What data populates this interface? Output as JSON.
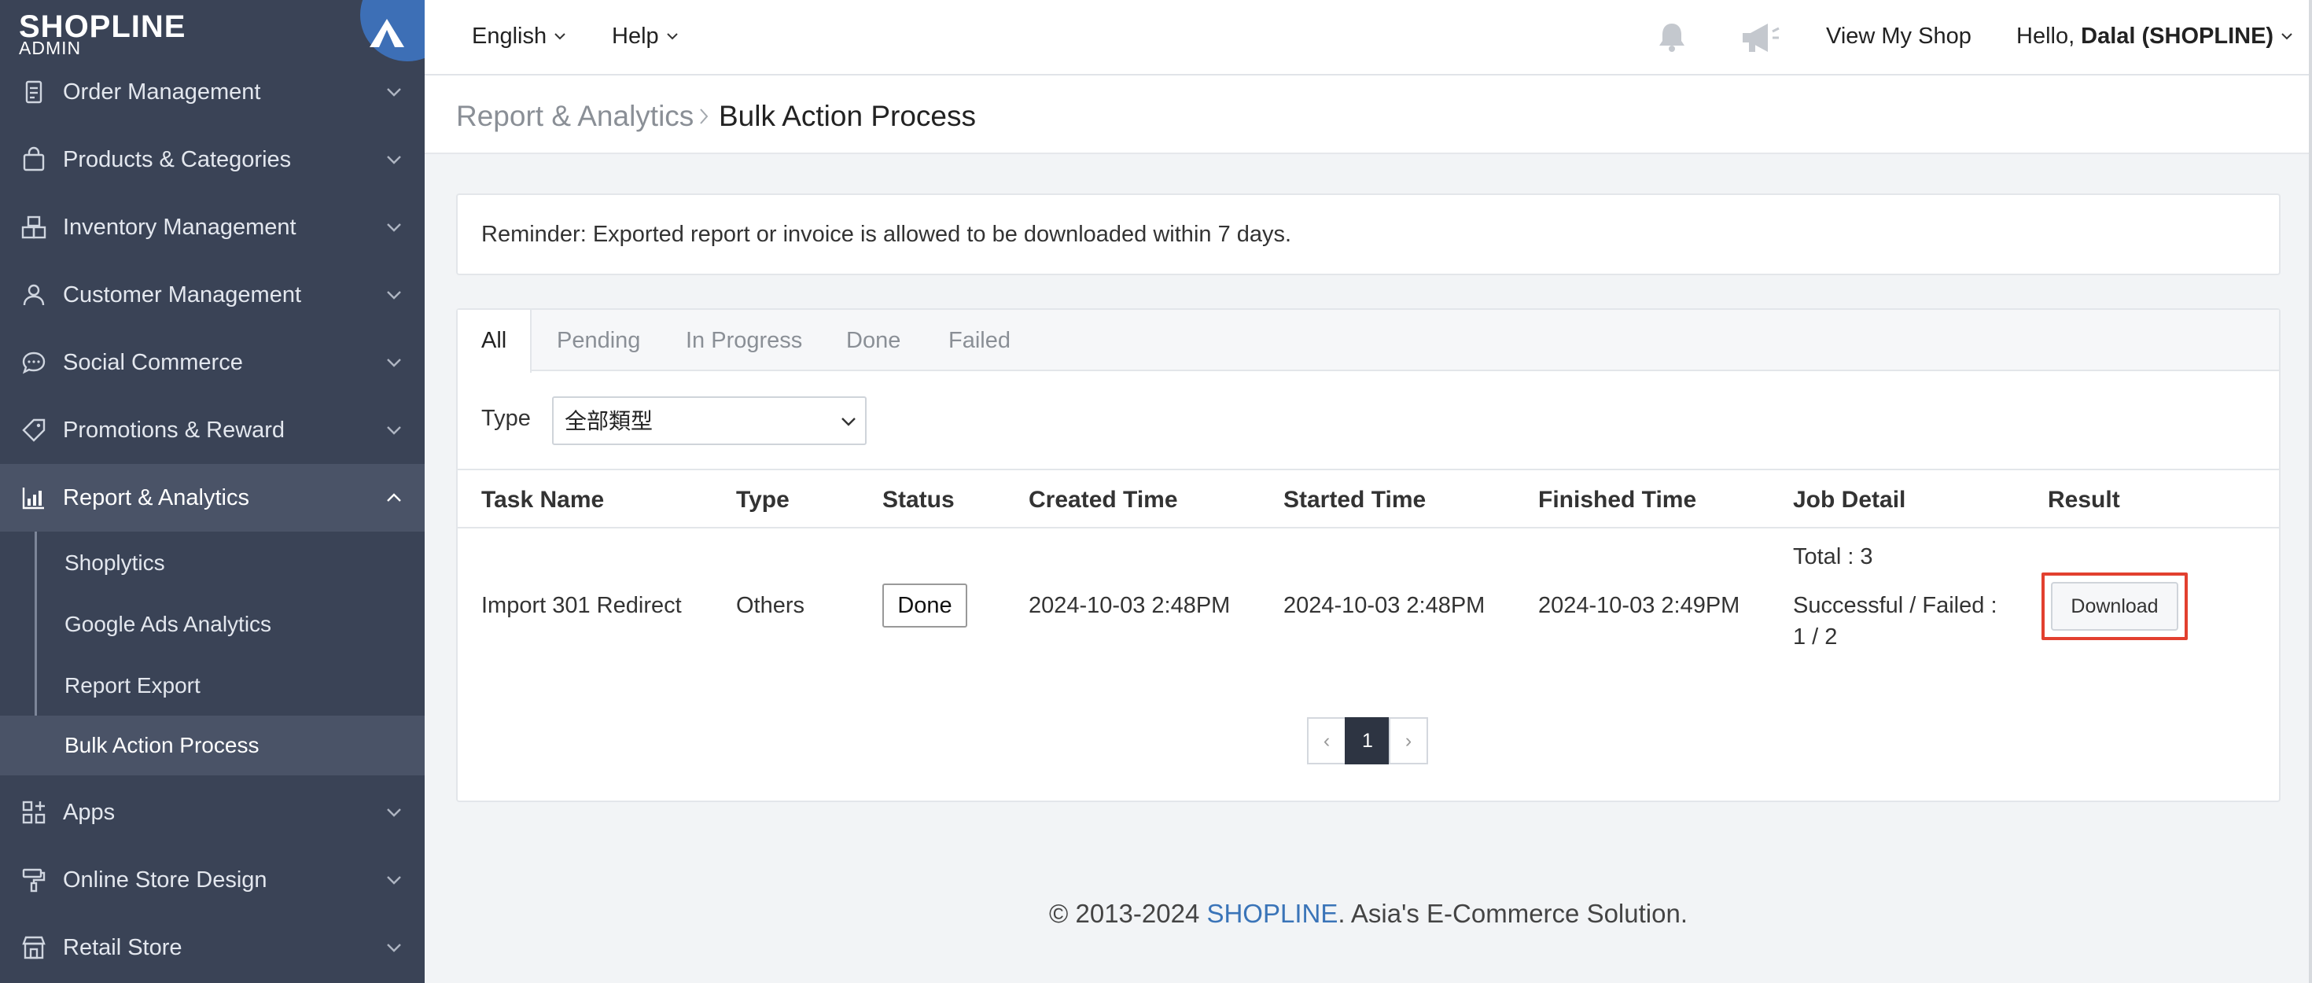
{
  "brand": {
    "name": "SHOPLINE",
    "sub": "ADMIN"
  },
  "sidebar": {
    "items": [
      {
        "label": "Order Management",
        "icon": "clipboard-icon"
      },
      {
        "label": "Products & Categories",
        "icon": "bag-icon"
      },
      {
        "label": "Inventory Management",
        "icon": "boxes-icon"
      },
      {
        "label": "Customer Management",
        "icon": "user-icon"
      },
      {
        "label": "Social Commerce",
        "icon": "chat-icon"
      },
      {
        "label": "Promotions & Reward",
        "icon": "tag-icon"
      },
      {
        "label": "Report & Analytics",
        "icon": "chart-icon",
        "expanded": true
      },
      {
        "label": "Apps",
        "icon": "apps-icon"
      },
      {
        "label": "Online Store Design",
        "icon": "paint-roller-icon"
      },
      {
        "label": "Retail Store",
        "icon": "store-icon"
      }
    ],
    "sub_items": [
      {
        "label": "Shoplytics"
      },
      {
        "label": "Google Ads Analytics"
      },
      {
        "label": "Report Export"
      },
      {
        "label": "Bulk Action Process",
        "active": true
      }
    ]
  },
  "topbar": {
    "language": "English",
    "help": "Help",
    "view_shop": "View My Shop",
    "greeting": "Hello,",
    "user": "Dalal (SHOPLINE)"
  },
  "breadcrumb": {
    "parent": "Report & Analytics",
    "current": "Bulk Action Process"
  },
  "reminder": "Reminder: Exported report or invoice is allowed to be downloaded within 7 days.",
  "tabs": [
    {
      "label": "All",
      "active": true
    },
    {
      "label": "Pending"
    },
    {
      "label": "In Progress"
    },
    {
      "label": "Done"
    },
    {
      "label": "Failed"
    }
  ],
  "filter": {
    "type_label": "Type",
    "type_value": "全部類型"
  },
  "table": {
    "columns": [
      "Task Name",
      "Type",
      "Status",
      "Created Time",
      "Started Time",
      "Finished Time",
      "Job Detail",
      "Result"
    ],
    "rows": [
      {
        "task_name": "Import 301 Redirect",
        "type": "Others",
        "status": "Done",
        "created": "2024-10-03 2:48PM",
        "started": "2024-10-03 2:48PM",
        "finished": "2024-10-03 2:49PM",
        "detail_total": "Total : 3",
        "detail_result_line1": "Successful / Failed :",
        "detail_result_line2": "1 / 2",
        "result_button": "Download"
      }
    ]
  },
  "pagination": {
    "prev": "‹",
    "current": "1",
    "next": "›"
  },
  "footer": {
    "prefix": "© 2013-2024 ",
    "brand": "SHOPLINE",
    "suffix": ". Asia's E-Commerce Solution."
  },
  "colors": {
    "sidebar_bg": "#3a4356",
    "sidebar_active": "#4a5367",
    "accent_blue": "#3a74b8",
    "highlight_red": "#e2402f"
  }
}
